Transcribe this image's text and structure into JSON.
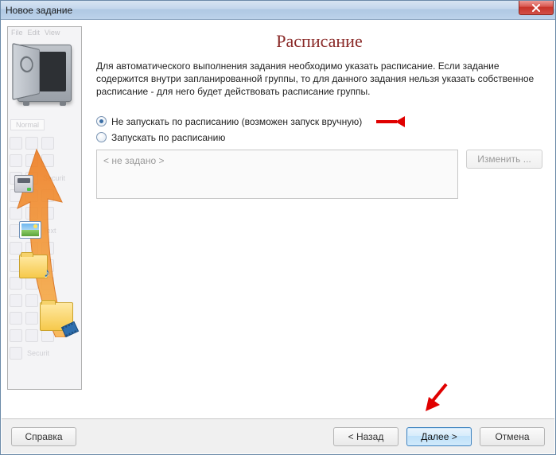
{
  "window": {
    "title": "Новое задание"
  },
  "sidebar_fake": {
    "menu": [
      "File",
      "Edit",
      "View"
    ],
    "tab": "Normal",
    "rows": [
      "",
      "Securit",
      "",
      "Text",
      "",
      "Securit"
    ]
  },
  "main": {
    "heading": "Расписание",
    "description": "Для автоматического выполнения задания необходимо указать расписание. Если задание содержится внутри запланированной группы, то для данного задания нельзя указать собственное расписание - для него будет действовать расписание группы.",
    "radio1": "Не запускать по расписанию (возможен запуск вручную)",
    "radio2": "Запускать по расписанию",
    "schedule_placeholder": "< не задано >",
    "change": "Изменить ..."
  },
  "footer": {
    "help": "Справка",
    "back": "< Назад",
    "next": "Далее >",
    "cancel": "Отмена"
  }
}
